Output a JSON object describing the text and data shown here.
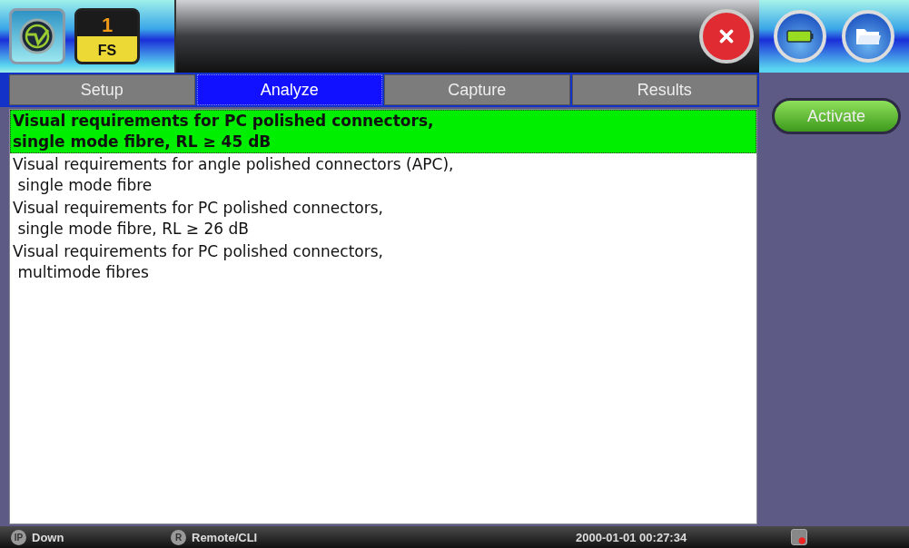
{
  "header": {
    "port_badge": {
      "number": "1",
      "label": "FS"
    }
  },
  "tabs": [
    {
      "label": "Setup",
      "selected": false
    },
    {
      "label": "Analyze",
      "selected": true
    },
    {
      "label": "Capture",
      "selected": false
    },
    {
      "label": "Results",
      "selected": false
    }
  ],
  "list": [
    {
      "lines": [
        "Visual requirements for PC polished connectors,",
        "single mode fibre, RL ≥ 45 dB"
      ],
      "selected": true
    },
    {
      "lines": [
        "Visual requirements for angle polished connectors (APC),",
        " single mode fibre"
      ],
      "selected": false
    },
    {
      "lines": [
        "Visual requirements for PC polished connectors,",
        " single mode fibre, RL ≥ 26 dB"
      ],
      "selected": false
    },
    {
      "lines": [
        "Visual requirements for PC polished connectors,",
        " multimode fibres"
      ],
      "selected": false
    }
  ],
  "side_buttons": [
    "Activate"
  ],
  "status_bar": {
    "ip": {
      "badge": "IP",
      "text": "Down"
    },
    "remote": {
      "badge": "R",
      "text": "Remote/CLI"
    },
    "datetime": "2000-01-01  00:27:34"
  }
}
